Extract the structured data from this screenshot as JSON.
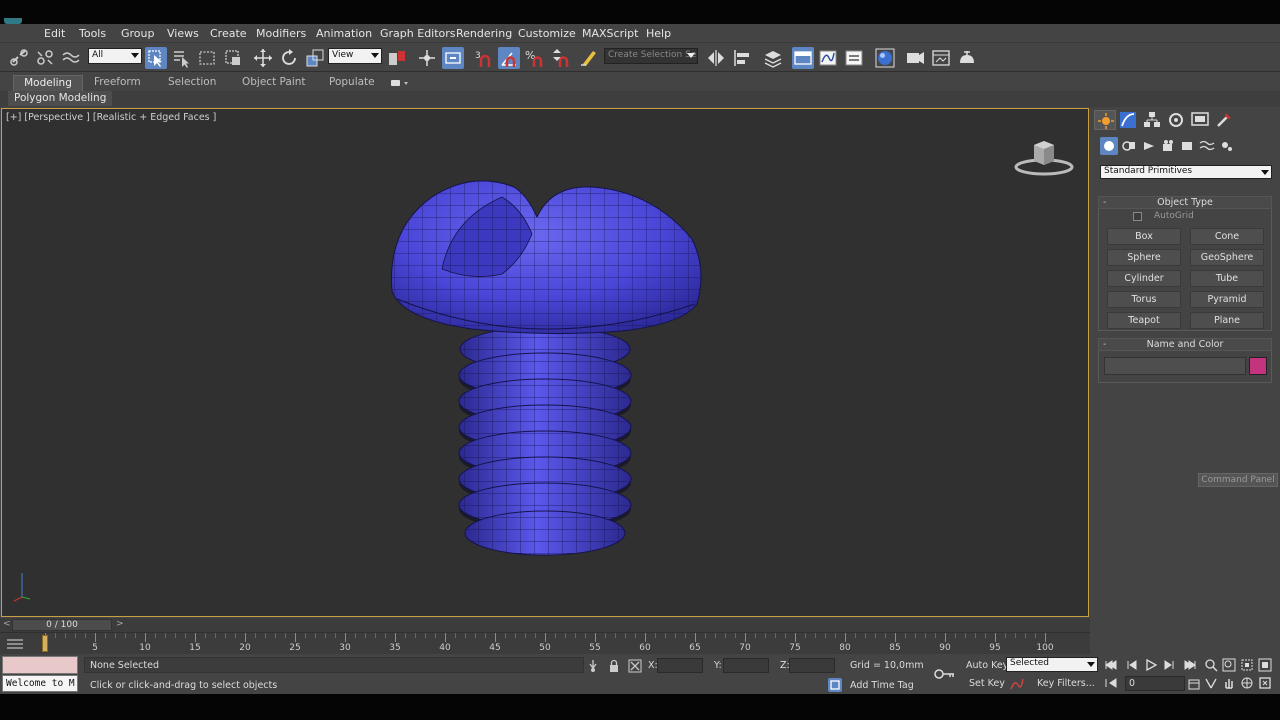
{
  "menu": [
    "Edit",
    "Tools",
    "Group",
    "Views",
    "Create",
    "Modifiers",
    "Animation",
    "Graph Editors",
    "Rendering",
    "Customize",
    "MAXScript",
    "Help"
  ],
  "toolbar": {
    "selection_filter": "All",
    "reference_coord": "View",
    "selection_set_placeholder": "Create Selection Se",
    "snap_label": "3"
  },
  "ribbon": {
    "tabs": [
      "Modeling",
      "Freeform",
      "Selection",
      "Object Paint",
      "Populate"
    ],
    "active": "Modeling",
    "sub_label": "Polygon Modeling"
  },
  "viewport": {
    "label": "[+] [Perspective ] [Realistic + Edged Faces ]",
    "object_color": "#4a46d8",
    "border_color": "#c8a040"
  },
  "command_panel": {
    "category_dropdown": "Standard Primitives",
    "object_type_title": "Object Type",
    "autogrid_label": "AutoGrid",
    "buttons": [
      "Box",
      "Cone",
      "Sphere",
      "GeoSphere",
      "Cylinder",
      "Tube",
      "Torus",
      "Pyramid",
      "Teapot",
      "Plane"
    ],
    "name_color_title": "Name and Color",
    "object_name": "",
    "swatch_color": "#c4347e",
    "tooltip": "Command Panel"
  },
  "timeline": {
    "frame_counter": "0 / 100",
    "ticks": [
      0,
      5,
      10,
      15,
      20,
      25,
      30,
      35,
      40,
      45,
      50,
      55,
      60,
      65,
      70,
      75,
      80,
      85,
      90,
      95,
      100
    ],
    "labeled": [
      "5",
      "10",
      "15",
      "20",
      "25",
      "30",
      "35",
      "40",
      "45",
      "50",
      "55",
      "60",
      "65",
      "70",
      "75",
      "80",
      "85",
      "90",
      "95",
      "100"
    ]
  },
  "status": {
    "selection": "None Selected",
    "prompt": "Click or click-and-drag to select objects",
    "listener": "Welcome to M",
    "x_label": "X:",
    "y_label": "Y:",
    "z_label": "Z:",
    "grid": "Grid = 10,0mm",
    "add_time_tag": "Add Time Tag",
    "auto_key": "Auto Key",
    "set_key": "Set Key",
    "key_mode": "Selected",
    "key_filters": "Key Filters...",
    "current_frame": "0"
  }
}
